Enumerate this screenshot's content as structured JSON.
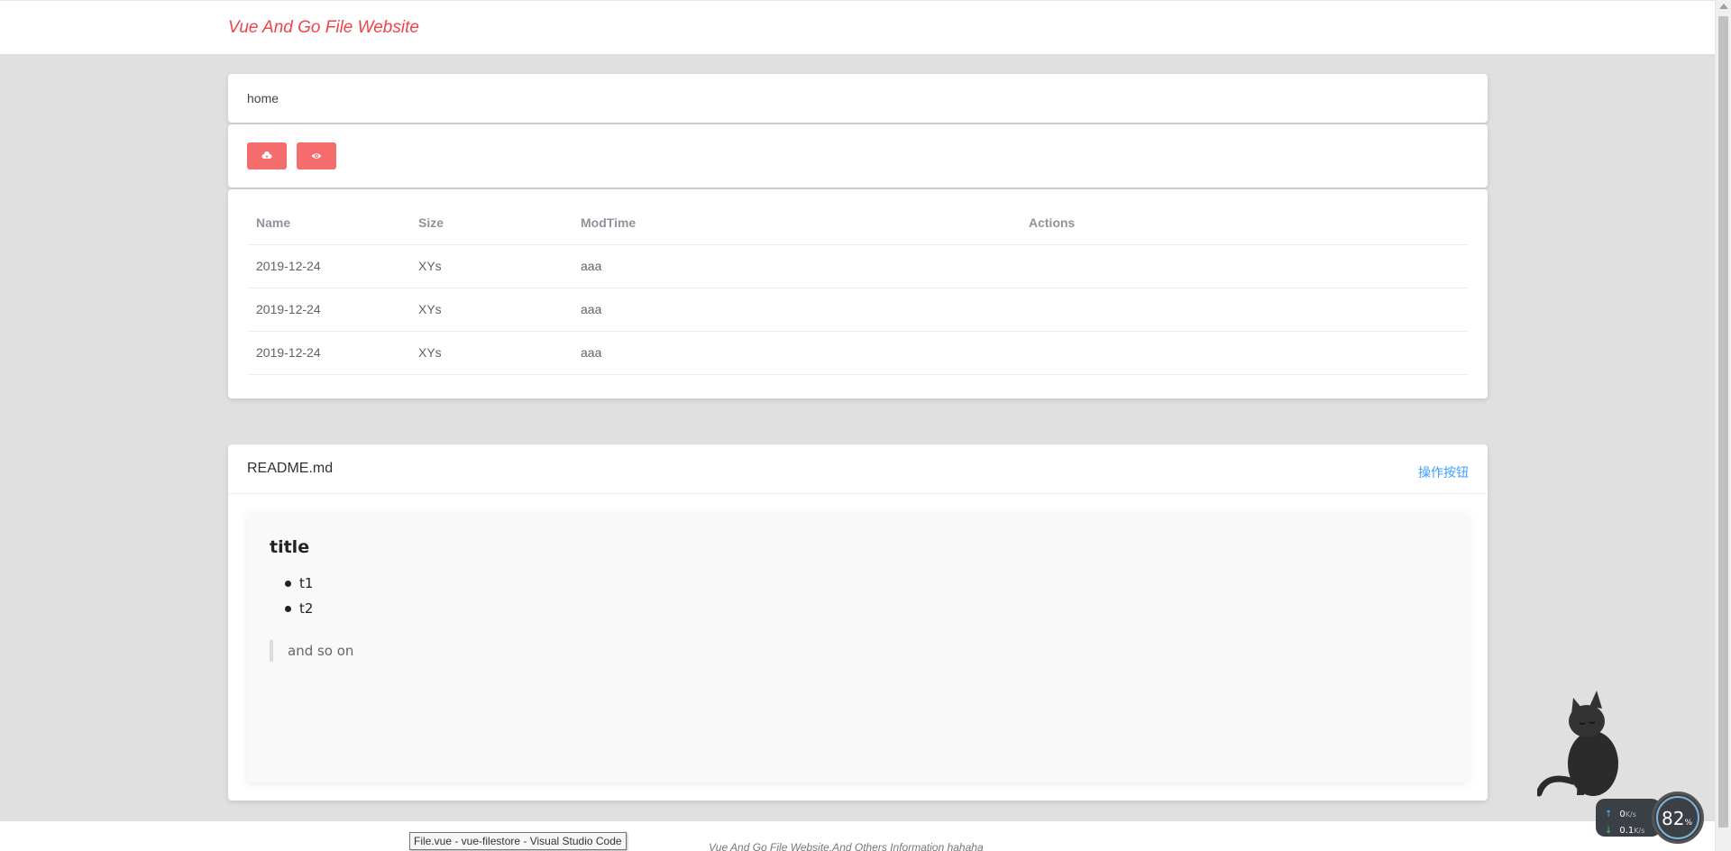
{
  "header": {
    "brand": "Vue And Go File Website"
  },
  "breadcrumb": {
    "path": "home"
  },
  "toolbar": {
    "buttons": [
      {
        "icon": "upload-cloud-icon"
      },
      {
        "icon": "eye-icon"
      }
    ],
    "accent_color": "#f56c6c"
  },
  "table": {
    "columns": [
      "Name",
      "Size",
      "ModTime",
      "Actions"
    ],
    "rows": [
      [
        "2019-12-24",
        "XYs",
        "aaa",
        ""
      ],
      [
        "2019-12-24",
        "XYs",
        "aaa",
        ""
      ],
      [
        "2019-12-24",
        "XYs",
        "aaa",
        ""
      ]
    ]
  },
  "readme": {
    "title": "README.md",
    "action_label": "操作按钮",
    "heading": "title",
    "list": [
      "t1",
      "t2"
    ],
    "quote": "and so on"
  },
  "footer": {
    "text": "Vue And Go File Website.And Others Information hahaha"
  },
  "tooltip": {
    "text": "File.vue - vue-filestore - Visual Studio Code"
  },
  "netmonitor": {
    "up_value": "0",
    "up_unit": "K/s",
    "down_value": "0.1",
    "down_unit": "K/s",
    "gauge_value": "82",
    "gauge_unit": "%"
  }
}
